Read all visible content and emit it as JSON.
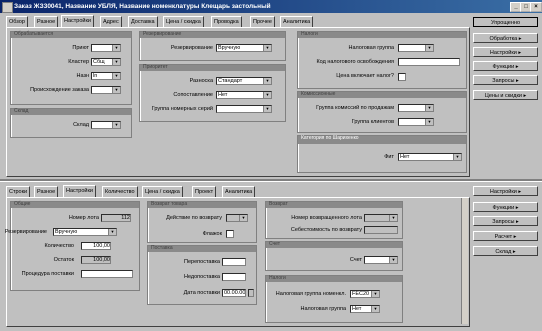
{
  "window": {
    "title": "Заказ ЖЗ30041, Название  УБЛЯ, Название номенклатуры Клещарь застольный",
    "min": "_",
    "max": "□",
    "close": "×"
  },
  "top_tabs": [
    "Обзор",
    "Разное",
    "Настройки",
    "Адрес",
    "Доставка",
    "Цена / скидка",
    "Проводка",
    "Прочее",
    "Аналитика"
  ],
  "top_active": 2,
  "top": {
    "g1": {
      "title": "Обрабатывается",
      "prima_label": "Приют",
      "cluster_label": "Кластер",
      "cluster_value": "Сбщ",
      "nazn_label": "Назн",
      "nazn_value": "ln",
      "origin_label": "Происхождение заказа"
    },
    "g1b": {
      "title": "Склад",
      "sklad_label": "Склад"
    },
    "g2": {
      "title": "Резервирование",
      "res_label": "Резервирование",
      "res_value": "Вручную"
    },
    "g3": {
      "title": "Приоритет",
      "razn_label": "Разноска",
      "razn_value": "Стандарт",
      "sop_label": "Сопоставление",
      "sop_value": "Нет",
      "grp_label": "Группа номерных серий"
    },
    "g4": {
      "title": "Налоги",
      "nalog_label": "Налоговая группа",
      "kod_label": "Код налогового освобождения",
      "incl_label": "Цена включает налог?"
    },
    "g5": {
      "title": "Комиссионные",
      "comm_label": "Группа комиссий по продажам",
      "agent_label": "Группа клиентов"
    },
    "g6": {
      "title": "Категория по Шарихенко",
      "fact_label": "Фит",
      "fact_value": "Нет"
    }
  },
  "top_side_buttons": [
    "Упрощенно",
    "Обработка ▸",
    "Настройки ▸",
    "Функции ▸",
    "Запросы ▸",
    "Цены и скидки ▸"
  ],
  "bottom_tabs": [
    "Строки",
    "Разное",
    "Настройки",
    "Количество",
    "Цена / скидка",
    "Проект",
    "Аналитика"
  ],
  "bottom_active": 2,
  "bottom": {
    "g1": {
      "title": "Общие",
      "lot_label": "Номер лота",
      "lot_value": "112",
      "res_label": "Резервирование",
      "res_value": "Вручную",
      "qty_label": "Количество",
      "qty_value": "100,00",
      "rem_label": "Остаток",
      "rem_value": "100,00",
      "supply_label": "Процедура поставки"
    },
    "g2": {
      "title": "Возврат товара",
      "action_label": "Действие по возврату",
      "flag_label": "Флажок"
    },
    "g3": {
      "title": "Поставка",
      "over_label": "Перепоставка",
      "under_label": "Недопоставка",
      "date_label": "Дата поставки",
      "date_value": "00.00.00"
    },
    "g4": {
      "title": "Возврат",
      "retlot_label": "Номер возвращенного лота",
      "cost_label": "Себестоимость по возврату"
    },
    "g5": {
      "title": "Счет",
      "acc_label": "Счет"
    },
    "g6": {
      "title": "Налоги",
      "tax_label": "Налоговая группа номенкл.",
      "tax_value": "FEC20",
      "tax2_label": "Налоговая группа",
      "tax2_value": "Нет"
    }
  },
  "bottom_side_buttons": [
    "Настройки ▸",
    "Функции ▸",
    "Запросы ▸",
    "Расчет ▸",
    "Склад ▸"
  ]
}
